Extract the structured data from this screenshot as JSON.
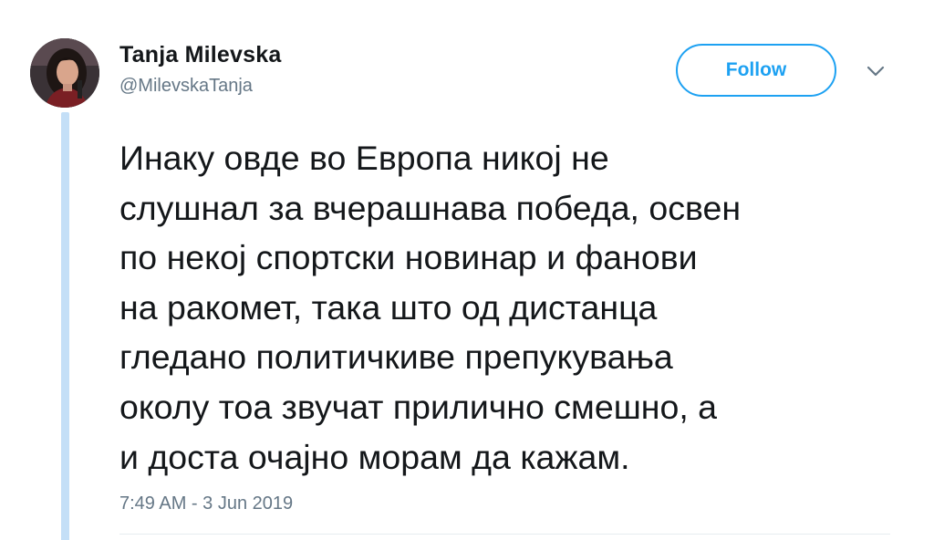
{
  "author": {
    "display_name": "Tanja Milevska",
    "handle": "@MilevskaTanja"
  },
  "actions": {
    "follow_label": "Follow",
    "menu_icon": "chevron-down-icon"
  },
  "tweet": {
    "lines": [
      "Инаку овде во Европа никој не",
      "слушнал за вчерашнава победа, освен",
      "по некој спортски новинар и фанови",
      "на ракомет, така што од дистанца",
      "гледано политичкиве препукувања",
      "околу тоа звучат прилично смешно, а",
      "и доста очајно морам да кажам."
    ],
    "timestamp": "7:49 AM - 3 Jun 2019"
  },
  "colors": {
    "accent": "#1da1f2",
    "text": "#14171a",
    "secondary_text": "#657786",
    "thread_line": "#c4dff7"
  }
}
